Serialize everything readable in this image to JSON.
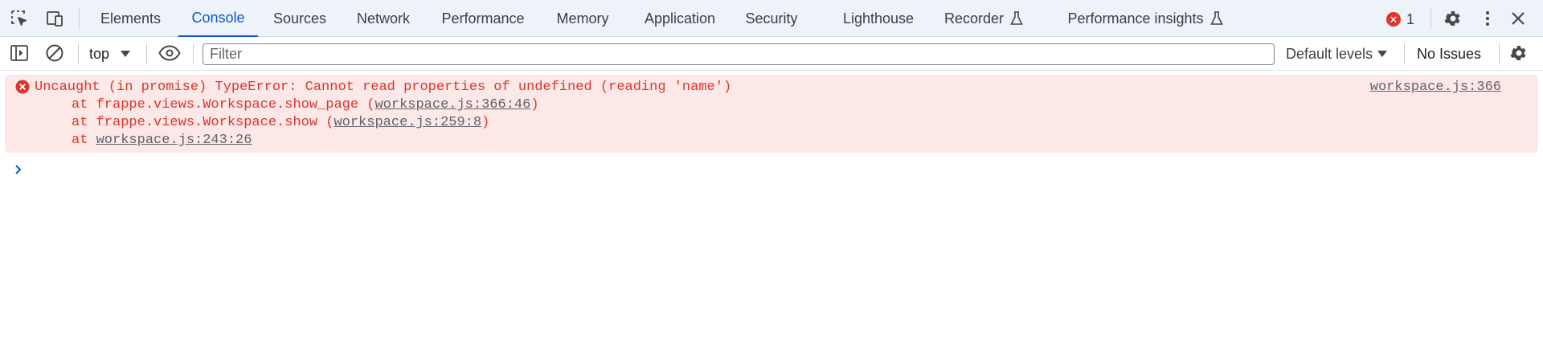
{
  "tabs": [
    {
      "label": "Elements",
      "active": false
    },
    {
      "label": "Console",
      "active": true
    },
    {
      "label": "Sources",
      "active": false
    },
    {
      "label": "Network",
      "active": false
    },
    {
      "label": "Performance",
      "active": false
    },
    {
      "label": "Memory",
      "active": false
    },
    {
      "label": "Application",
      "active": false
    },
    {
      "label": "Security",
      "active": false
    },
    {
      "label": "Lighthouse",
      "active": false
    },
    {
      "label": "Recorder",
      "active": false,
      "icon": "flask-icon"
    },
    {
      "label": "Performance insights",
      "active": false,
      "icon": "flask-icon"
    }
  ],
  "status": {
    "error_count": "1"
  },
  "toolbar": {
    "context": "top",
    "filter_placeholder": "Filter",
    "filter_value": "",
    "levels": "Default levels",
    "issues": "No Issues"
  },
  "console": {
    "error": {
      "message": "Uncaught (in promise) TypeError: Cannot read properties of undefined (reading 'name')",
      "source": "workspace.js:366",
      "stack": [
        {
          "prefix": "at frappe.views.Workspace.show_page (",
          "link": "workspace.js:366:46",
          "suffix": ")"
        },
        {
          "prefix": "at frappe.views.Workspace.show (",
          "link": "workspace.js:259:8",
          "suffix": ")"
        },
        {
          "prefix": "at ",
          "link": "workspace.js:243:26",
          "suffix": ""
        }
      ]
    }
  },
  "colors": {
    "accent": "#0b57d0",
    "error": "#dc362e",
    "error_bg": "#fce8e6",
    "tabbar_bg": "#eef2f9"
  }
}
